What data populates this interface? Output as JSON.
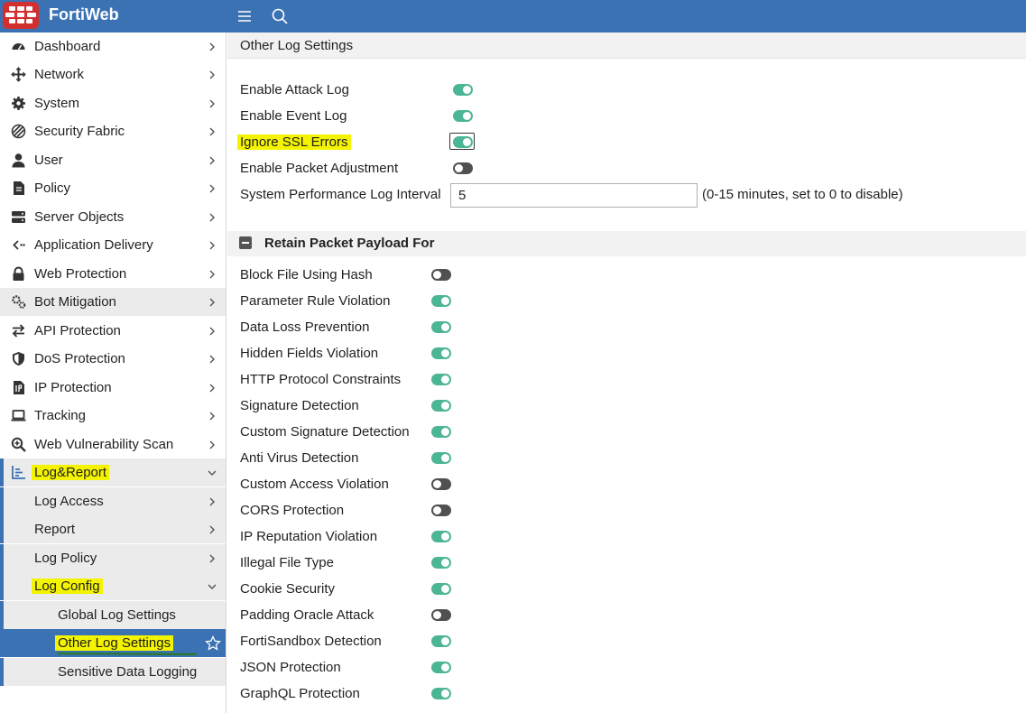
{
  "app": {
    "brand": "FortiWeb"
  },
  "sidebar": {
    "items": [
      {
        "label": "Dashboard",
        "icon": "dashboard-icon"
      },
      {
        "label": "Network",
        "icon": "network-icon"
      },
      {
        "label": "System",
        "icon": "gear-icon"
      },
      {
        "label": "Security Fabric",
        "icon": "security-fabric-icon"
      },
      {
        "label": "User",
        "icon": "user-icon"
      },
      {
        "label": "Policy",
        "icon": "policy-icon"
      },
      {
        "label": "Server Objects",
        "icon": "server-icon"
      },
      {
        "label": "Application Delivery",
        "icon": "application-delivery-icon"
      },
      {
        "label": "Web Protection",
        "icon": "lock-icon"
      },
      {
        "label": "Bot Mitigation",
        "icon": "bot-icon"
      },
      {
        "label": "API Protection",
        "icon": "arrows-icon"
      },
      {
        "label": "DoS Protection",
        "icon": "shield-icon"
      },
      {
        "label": "IP Protection",
        "icon": "ip-document-icon"
      },
      {
        "label": "Tracking",
        "icon": "laptop-icon"
      },
      {
        "label": "Web Vulnerability Scan",
        "icon": "magnifier-plus-icon"
      },
      {
        "label": "Log&Report",
        "icon": "chart-icon"
      }
    ],
    "sub_items": [
      {
        "label": "Log Access"
      },
      {
        "label": "Report"
      },
      {
        "label": "Log Policy"
      },
      {
        "label": "Log Config"
      }
    ],
    "leaf_items": [
      {
        "label": "Global Log Settings"
      },
      {
        "label": "Other Log Settings"
      },
      {
        "label": "Sensitive Data Logging"
      }
    ]
  },
  "main": {
    "title": "Other Log Settings",
    "settings": [
      {
        "label": "Enable Attack Log",
        "state": "on"
      },
      {
        "label": "Enable Event Log",
        "state": "on"
      },
      {
        "label": "Ignore SSL Errors",
        "state": "on"
      },
      {
        "label": "Enable Packet Adjustment",
        "state": "off"
      }
    ],
    "interval": {
      "label": "System Performance Log Interval",
      "value": "5",
      "hint": "(0-15 minutes, set to 0 to disable)"
    },
    "section_title": "Retain Packet Payload For",
    "payload_items": [
      {
        "label": "Block File Using Hash",
        "state": "off"
      },
      {
        "label": "Parameter Rule Violation",
        "state": "on"
      },
      {
        "label": "Data Loss Prevention",
        "state": "on"
      },
      {
        "label": "Hidden Fields Violation",
        "state": "on"
      },
      {
        "label": "HTTP Protocol Constraints",
        "state": "on"
      },
      {
        "label": "Signature Detection",
        "state": "on"
      },
      {
        "label": "Custom Signature Detection",
        "state": "on"
      },
      {
        "label": "Anti Virus Detection",
        "state": "on"
      },
      {
        "label": "Custom Access Violation",
        "state": "off"
      },
      {
        "label": "CORS Protection",
        "state": "off"
      },
      {
        "label": "IP Reputation Violation",
        "state": "on"
      },
      {
        "label": "Illegal File Type",
        "state": "on"
      },
      {
        "label": "Cookie Security",
        "state": "on"
      },
      {
        "label": "Padding Oracle Attack",
        "state": "off"
      },
      {
        "label": "FortiSandbox Detection",
        "state": "on"
      },
      {
        "label": "JSON Protection",
        "state": "on"
      },
      {
        "label": "GraphQL Protection",
        "state": "on"
      }
    ]
  },
  "colors": {
    "topbar": "#3a72b4",
    "toggle_on": "#4cb596",
    "toggle_off": "#505050",
    "highlight": "#f4f400"
  }
}
